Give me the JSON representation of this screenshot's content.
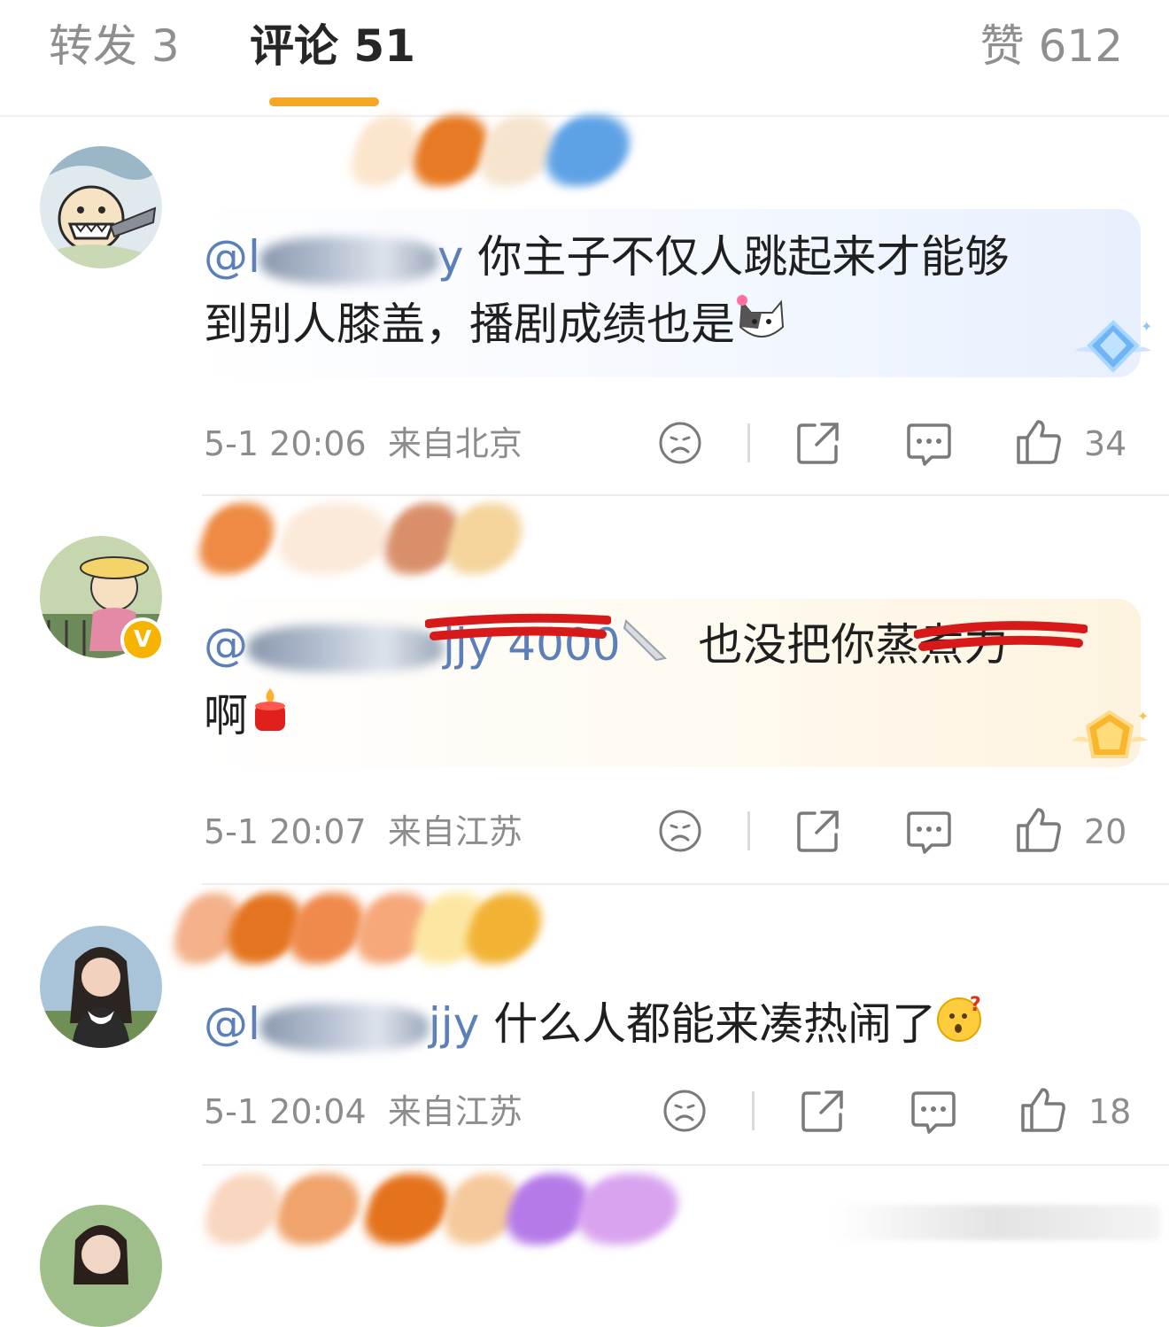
{
  "tabs": {
    "repost": "转发 3",
    "comments": "评论 51",
    "likes": "赞 612"
  },
  "comments": [
    {
      "mention_prefix": "@l",
      "mention_suffix": "y",
      "text_line1": "你主子不仅人跳起来才能够",
      "text_line2": "到别人膝盖，播剧成绩也是",
      "time": "5-1 20:06",
      "location": "来自北京",
      "likes": "34"
    },
    {
      "mention_prefix": "@",
      "mention_suffix": "jjy 4000",
      "text_line1": "也没把你蒸煮力",
      "text_line2": "啊",
      "time": "5-1 20:07",
      "location": "来自江苏",
      "likes": "20"
    },
    {
      "mention_prefix": "@l",
      "mention_suffix": "jjy",
      "text_line1": "什么人都能来凑热闹了",
      "time": "5-1 20:04",
      "location": "来自江苏",
      "likes": "18"
    }
  ],
  "icons": [
    "dislike-face-icon",
    "share-icon",
    "reply-icon",
    "thumbs-up-icon",
    "cat-emoji-icon",
    "candle-emoji-icon",
    "thinking-face-emoji-icon",
    "knife-emoji-icon",
    "blue-diamond-badge-icon",
    "gold-diamond-badge-icon"
  ],
  "colors": {
    "accent": "#f5a623",
    "mention": "#5b7fb8",
    "meta": "#8c8c8c"
  }
}
